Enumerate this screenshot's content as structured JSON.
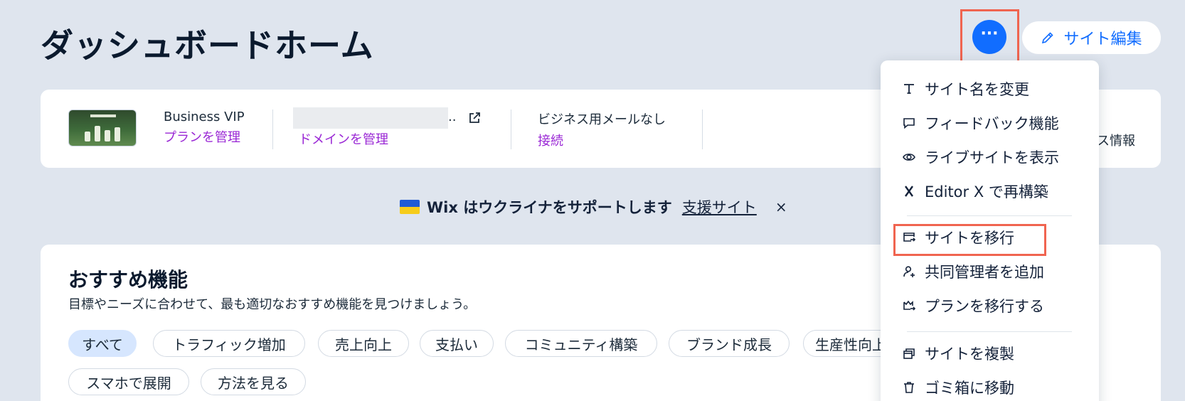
{
  "page": {
    "title": "ダッシュボードホーム"
  },
  "header": {
    "more_label": "···",
    "edit_label": "サイト編集"
  },
  "site_card": {
    "plan_name": "Business VIP",
    "plan_link": "プランを管理",
    "domain_ellipsis": "..",
    "domain_link": "ドメインを管理",
    "email_label": "ビジネス用メールなし",
    "email_link": "接続",
    "right_partial": "ス情報"
  },
  "banner": {
    "text": "Wix はウクライナをサポートします",
    "link": "支援サイト",
    "close": "×"
  },
  "recommended": {
    "title": "おすすめ機能",
    "subtitle": "目標やニーズに合わせて、最も適切なおすすめ機能を見つけましょう。",
    "chips": [
      "すべて",
      "トラフィック増加",
      "売上向上",
      "支払い",
      "コミュニティ構築",
      "ブランド成長",
      "生産性向上",
      "スマホで展開",
      "方法を見る"
    ]
  },
  "menu": {
    "items": [
      {
        "label": "サイト名を変更",
        "icon": "text-icon"
      },
      {
        "label": "フィードバック機能",
        "icon": "comment-icon"
      },
      {
        "label": "ライブサイトを表示",
        "icon": "eye-icon"
      },
      {
        "label": "Editor X で再構築",
        "icon": "editor-x-icon"
      },
      {
        "label": "サイトを移行",
        "icon": "transfer-icon"
      },
      {
        "label": "共同管理者を追加",
        "icon": "add-user-icon"
      },
      {
        "label": "プランを移行する",
        "icon": "plan-transfer-icon"
      },
      {
        "label": "サイトを複製",
        "icon": "duplicate-icon"
      },
      {
        "label": "ゴミ箱に移動",
        "icon": "trash-icon"
      }
    ]
  },
  "colors": {
    "background": "#dfe5ee",
    "accent": "#116dff",
    "link": "#9a27d5",
    "highlight": "#f06450"
  }
}
